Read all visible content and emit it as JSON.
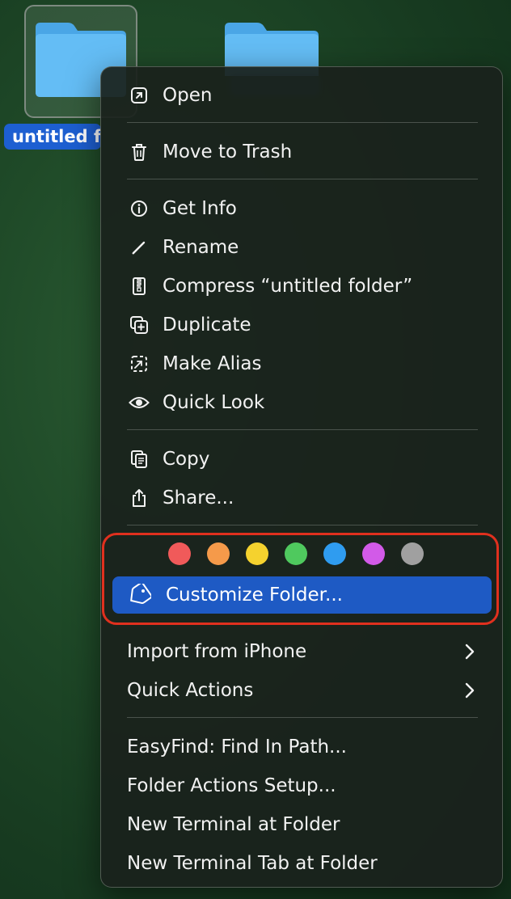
{
  "desktop": {
    "folder1_label": "untitled f",
    "selection_color": "#1d5fd1",
    "folder_color": "#5ab4f0"
  },
  "menu": {
    "group1": [
      {
        "label": "Open",
        "icon": "open-external-icon"
      },
      {
        "label": "Move to Trash",
        "icon": "trash-icon"
      }
    ],
    "group2": [
      {
        "label": "Get Info",
        "icon": "info-icon"
      },
      {
        "label": "Rename",
        "icon": "pencil-icon"
      },
      {
        "label": "Compress “untitled folder”",
        "icon": "zip-icon"
      },
      {
        "label": "Duplicate",
        "icon": "duplicate-icon"
      },
      {
        "label": "Make Alias",
        "icon": "alias-icon"
      },
      {
        "label": "Quick Look",
        "icon": "eye-icon"
      }
    ],
    "group3": [
      {
        "label": "Copy",
        "icon": "copy-icon"
      },
      {
        "label": "Share...",
        "icon": "share-icon"
      }
    ],
    "tags": [
      {
        "name": "red",
        "color": "#f05a5a"
      },
      {
        "name": "orange",
        "color": "#f59a4a"
      },
      {
        "name": "yellow",
        "color": "#f5d22e"
      },
      {
        "name": "green",
        "color": "#4fc95e"
      },
      {
        "name": "blue",
        "color": "#2f9cf0"
      },
      {
        "name": "purple",
        "color": "#d25ae8"
      },
      {
        "name": "gray",
        "color": "#a0a0a0"
      }
    ],
    "customize": {
      "label": "Customize Folder...",
      "icon": "tag-icon",
      "highlight_color": "#1e5ac4"
    },
    "group4": [
      {
        "label": "Import from iPhone",
        "submenu": true
      },
      {
        "label": "Quick Actions",
        "submenu": true
      }
    ],
    "group5": [
      {
        "label": "EasyFind: Find In Path..."
      },
      {
        "label": "Folder Actions Setup..."
      },
      {
        "label": "New Terminal at Folder"
      },
      {
        "label": "New Terminal Tab at Folder"
      }
    ]
  }
}
